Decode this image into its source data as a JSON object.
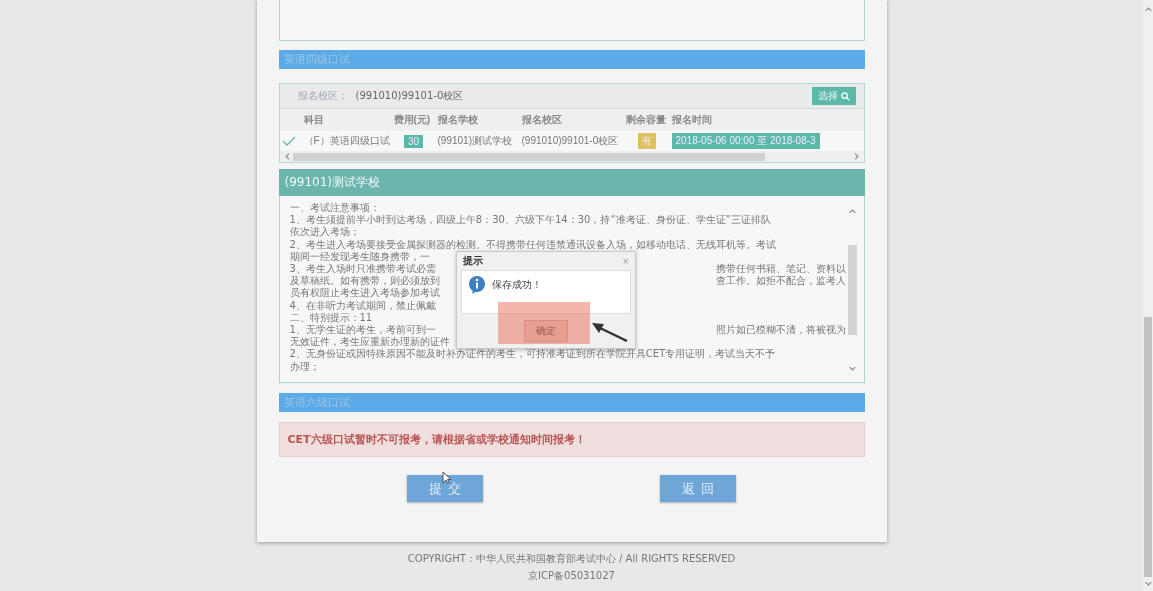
{
  "cet4": {
    "title": "英语四级口试",
    "campus_label": "报名校区：",
    "campus_value": "(991010)99101-0校区",
    "select_button": "选择",
    "columns": [
      "科目",
      "费用(元)",
      "报名学校",
      "报名校区",
      "剩余容量",
      "报名时间"
    ],
    "rows": [
      {
        "checked": true,
        "cells": [
          {
            "kind": "text",
            "text": "（F）英语四级口试"
          },
          {
            "kind": "fee",
            "text": "30"
          },
          {
            "kind": "text",
            "text": "(99101)测试学校"
          },
          {
            "kind": "text",
            "text": "(991010)99101-0校区"
          },
          {
            "kind": "capacity",
            "text": "有"
          },
          {
            "kind": "period",
            "text": "2018-05-06 00:00 至 2018-08-3"
          }
        ]
      }
    ]
  },
  "school": {
    "title": "(99101)测试学校",
    "notice_lines": [
      {
        "left": "一、考试注意事项："
      },
      {
        "left": "1、考生须提前半小时到达考场，四级上午8：30、六级下午14：30，持“准考证、身份证、学生证”三证排队"
      },
      {
        "left": "依次进入考场；"
      },
      {
        "left": "2、考生进入考场要接受金属探测器的检测。不得携带任何违禁通讯设备入场，如移动电话、无线耳机等。考试"
      },
      {
        "left": "期间一经发现考生随身携带，一"
      },
      {
        "left": "3、考生入场时只准携带考试必需",
        "right": "携带任何书籍、笔记、资料以"
      },
      {
        "left": "及草稿纸。如有携带，则必须放到",
        "right": "查工作。如拒不配合，监考人"
      },
      {
        "left": "员有权阻止考生进入考场参加考试"
      },
      {
        "left": "4、在非听力考试期间，禁止佩戴"
      },
      {
        "left": "二、特别提示：11"
      },
      {
        "left": "1、无学生证的考生，考前可到一",
        "right": "照片如已模糊不清，将被视为"
      },
      {
        "left": "无效证件，考生应重新办理新的证件"
      },
      {
        "left": "2、无身份证或因特殊原因不能及时补办证件的考生，可持准考证到所在学院开具CET专用证明，考试当天不予"
      },
      {
        "left": "办理；"
      }
    ]
  },
  "dialog": {
    "title": "提示",
    "close": "×",
    "message": "保存成功！",
    "ok": "确定"
  },
  "cet6": {
    "title": "英语六级口试",
    "alert": "CET六级口试暂时不可报考，请根据省或学校通知时间报考！"
  },
  "buttons": [
    "提交",
    "返回"
  ],
  "footer": [
    "COPYRIGHT：中华人民共和国教育部考试中心 / All RIGHTS RESERVED",
    "京ICP备05031027"
  ]
}
